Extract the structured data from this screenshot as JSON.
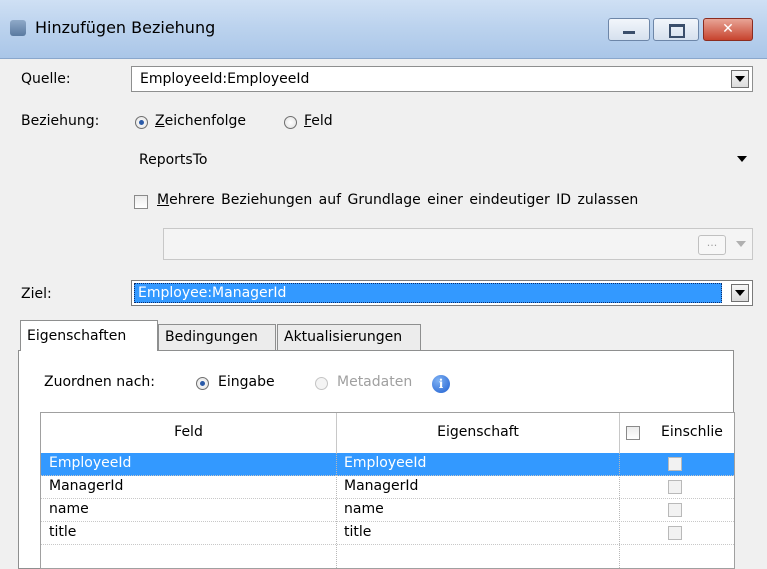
{
  "window": {
    "title": "Hinzufügen Beziehung",
    "buttons": {
      "minimize": "–",
      "maximize": "□",
      "close": "✕"
    }
  },
  "form": {
    "quelle_label": "Quelle:",
    "quelle_value": "EmployeeId:EmployeeId",
    "beziehung_label": "Beziehung:",
    "radio_zeichenfolge": "Zeichenfolge",
    "radio_feld": "Feld",
    "beziehung_value": "ReportsTo",
    "mehrere_label": "Mehrere Beziehungen auf Grundlage einer eindeutiger ID zulassen",
    "id_field_value": "",
    "ellipsis": "...",
    "ziel_label": "Ziel:",
    "ziel_value": "Employee:ManagerId"
  },
  "tabs": [
    {
      "label": "Eigenschaften",
      "active": true
    },
    {
      "label": "Bedingungen",
      "active": false
    },
    {
      "label": "Aktualisierungen",
      "active": false
    }
  ],
  "mapping": {
    "zuordnen_label": "Zuordnen nach:",
    "radio_eingabe": "Eingabe",
    "radio_metadaten": "Metadaten",
    "info_icon": "i"
  },
  "grid": {
    "columns": [
      "Feld",
      "Eigenschaft",
      "Einschlie"
    ],
    "rows": [
      {
        "feld": "EmployeeId",
        "eigenschaft": "EmployeeId",
        "selected": true
      },
      {
        "feld": "ManagerId",
        "eigenschaft": "ManagerId",
        "selected": false
      },
      {
        "feld": "name",
        "eigenschaft": "name",
        "selected": false
      },
      {
        "feld": "title",
        "eigenschaft": "title",
        "selected": false
      }
    ]
  },
  "colors": {
    "selection": "#3399ff",
    "titlebar": "#bcd3ee"
  }
}
